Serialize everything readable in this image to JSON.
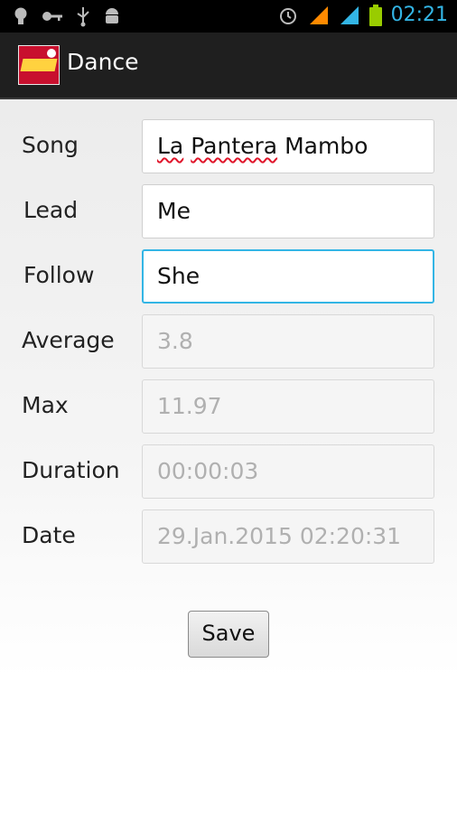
{
  "status_bar": {
    "time": "02:21",
    "icons": [
      "lightbulb-icon",
      "key-icon",
      "usb-icon",
      "android-icon",
      "alarm-icon",
      "signal-icon",
      "signal-icon",
      "battery-icon"
    ]
  },
  "action_bar": {
    "title": "Dance"
  },
  "form": {
    "song": {
      "label": "Song",
      "value": "La Pantera Mambo",
      "value_parts": [
        "La",
        "Pantera",
        "Mambo"
      ]
    },
    "lead": {
      "label": "Lead",
      "value": "Me"
    },
    "follow": {
      "label": "Follow",
      "value": "She"
    },
    "average": {
      "label": "Average",
      "value": "3.8"
    },
    "max": {
      "label": "Max",
      "value": "11.97"
    },
    "duration": {
      "label": "Duration",
      "value": "00:00:03"
    },
    "date": {
      "label": "Date",
      "value": "29.Jan.2015 02:20:31"
    }
  },
  "save_label": "Save",
  "colors": {
    "accent": "#33b5e5",
    "signal": "#ff8a00",
    "battery": "#99cc00",
    "spellcheck": "#e0162b"
  }
}
